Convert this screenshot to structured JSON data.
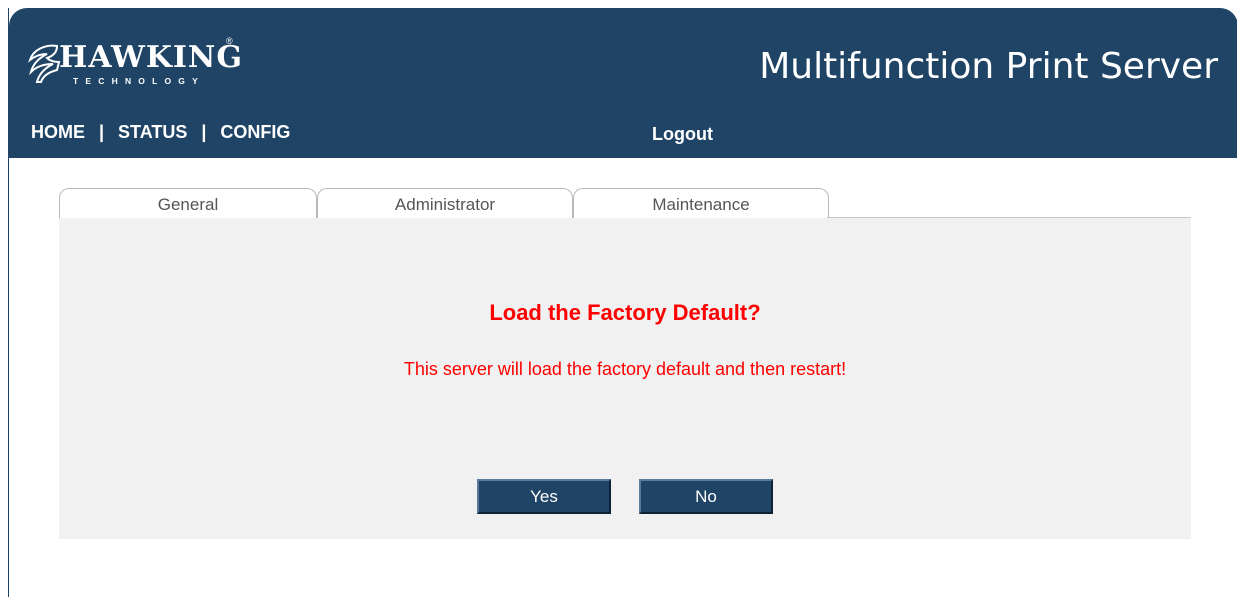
{
  "logo": {
    "wordmark": "HAWKING",
    "registered": "®",
    "subtitle": "TECHNOLOGY"
  },
  "header": {
    "product_title": "Multifunction Print Server"
  },
  "nav": {
    "items": [
      {
        "label": "HOME"
      },
      {
        "label": "STATUS"
      },
      {
        "label": "CONFIG"
      }
    ],
    "separator": "|",
    "logout": "Logout"
  },
  "tabs": [
    {
      "label": "General"
    },
    {
      "label": "Administrator"
    },
    {
      "label": "Maintenance"
    }
  ],
  "dialog": {
    "title": "Load the Factory Default?",
    "message": "This server will load the factory default and then restart!",
    "yes_label": "Yes",
    "no_label": "No"
  },
  "colors": {
    "header_bg": "#1f4466",
    "panel_bg": "#f1f1f1",
    "warning_text": "#ff0000"
  }
}
